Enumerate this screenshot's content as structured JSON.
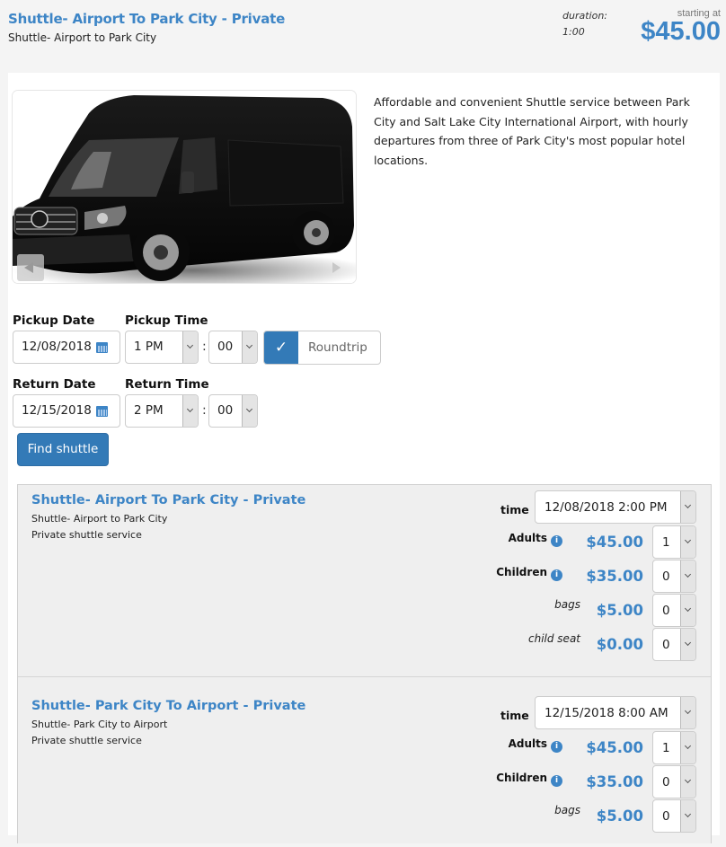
{
  "header": {
    "title": "Shuttle- Airport To Park City - Private",
    "subtitle": "Shuttle- Airport to Park City",
    "duration_label": "duration:",
    "duration_value": "1:00",
    "starting_label": "starting at",
    "starting_price": "$45.00"
  },
  "description": "Affordable and convenient Shuttle service between Park City and Salt Lake City International Airport, with hourly departures from three of Park City's most popular hotel locations.",
  "gallery": {
    "prev_icon": "triangle-left",
    "next_icon": "triangle-right"
  },
  "form": {
    "pickup_date_label": "Pickup Date",
    "pickup_date_value": "12/08/2018",
    "pickup_time_label": "Pickup Time",
    "pickup_hour": "1 PM",
    "pickup_minute": "00",
    "time_separator": ":",
    "roundtrip_checked_icon": "✓",
    "roundtrip_label": "Roundtrip",
    "return_date_label": "Return Date",
    "return_date_value": "12/15/2018",
    "return_time_label": "Return Time",
    "return_hour": "2 PM",
    "return_minute": "00",
    "find_button": "Find shuttle"
  },
  "results": [
    {
      "title": "Shuttle- Airport To Park City - Private",
      "subtitle": "Shuttle- Airport to Park City",
      "description": "Private shuttle service",
      "time_label": "time",
      "time_value": "12/08/2018  2:00 PM",
      "options": [
        {
          "label": "Adults",
          "info": "i",
          "price": "$45.00",
          "qty": "1"
        },
        {
          "label": "Children",
          "info": "i",
          "price": "$35.00",
          "qty": "0"
        },
        {
          "label": "bags",
          "price": "$5.00",
          "qty": "0"
        },
        {
          "label": "child seat",
          "price": "$0.00",
          "qty": "0"
        }
      ]
    },
    {
      "title": "Shuttle- Park City To Airport - Private",
      "subtitle": "Shuttle- Park City to Airport",
      "description": "Private shuttle service",
      "time_label": "time",
      "time_value": "12/15/2018 8:00 AM",
      "options": [
        {
          "label": "Adults",
          "info": "i",
          "price": "$45.00",
          "qty": "1"
        },
        {
          "label": "Children",
          "info": "i",
          "price": "$35.00",
          "qty": "0"
        },
        {
          "label": "bags",
          "price": "$5.00",
          "qty": "0"
        }
      ]
    }
  ],
  "colors": {
    "accent": "#3d85c6",
    "button": "#337ab7",
    "page_bg": "#f4f4f4",
    "results_bg": "#efefef"
  }
}
